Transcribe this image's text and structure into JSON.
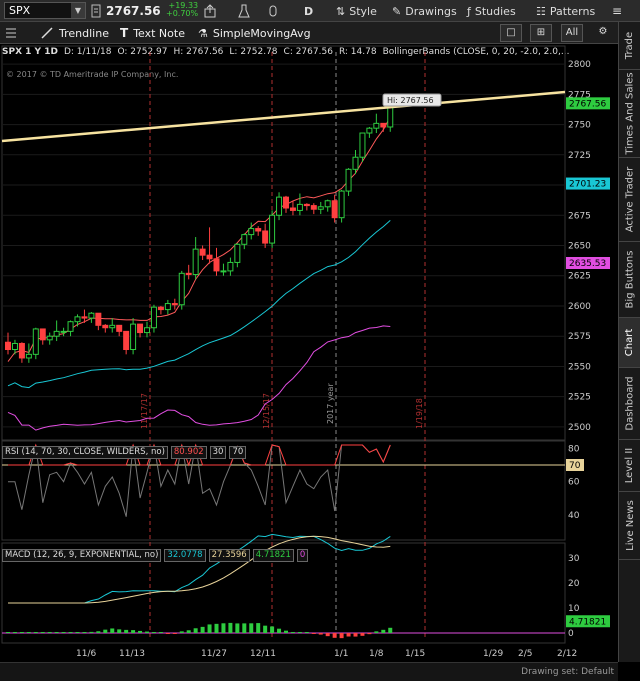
{
  "toolbar": {
    "symbol": "SPX",
    "last_price": "2767.56",
    "change": "+19.33",
    "change_pct": "+0.70%",
    "period_letter": "D",
    "style_label": "Style",
    "drawings_label": "Drawings",
    "studies_label": "Studies",
    "patterns_label": "Patterns"
  },
  "toolbar2": {
    "trendline_label": "Trendline",
    "textnote_label": "Text Note",
    "sma_label": "SimpleMovingAvg",
    "grid_label": "All"
  },
  "info": {
    "symbol_period": "SPX 1 Y 1D",
    "date": "D: 1/11/18",
    "open": "O: 2752.97",
    "high": "H: 2767.56",
    "low": "L: 2752.78",
    "close": "C: 2767.56",
    "range": "R: 14.78",
    "study": "BollingerBands (CLOSE, 0, 20, -2.0, 2.0,...",
    "copyright": "© 2017 © TD Ameritrade IP Company, Inc."
  },
  "sidetabs": [
    "Trade",
    "Times And Sales",
    "Active Trader",
    "Big Buttons",
    "Chart",
    "Dashboard",
    "Level II",
    "Live News"
  ],
  "active_tab": "Chart",
  "price_axis": [
    "2800",
    "2775",
    "2750",
    "2725",
    "2700",
    "2675",
    "2650",
    "2625",
    "2600",
    "2575",
    "2550",
    "2525",
    "2500"
  ],
  "price_tags": {
    "last": "2767.56",
    "upper": "2701.23",
    "lower": "2635.53",
    "hi_callout": "Hi: 2767.56"
  },
  "vertical_markers": [
    "11/17/17",
    "12/15/17",
    "2017 year",
    "1/19/18"
  ],
  "rsi": {
    "label": "RSI (14, 70, 30, CLOSE, WILDERS, no)",
    "value": "80.902",
    "oversold": "30",
    "overbought": "70",
    "axis": [
      "80",
      "60",
      "40"
    ],
    "tag": "70"
  },
  "macd": {
    "label": "MACD (12, 26, 9, EXPONENTIAL, no)",
    "value": "32.0778",
    "avg": "27.3596",
    "diff": "4.71821",
    "zero": "0",
    "axis": [
      "30",
      "20",
      "10",
      "0"
    ],
    "tag": "4.71821"
  },
  "date_axis": [
    "11/6",
    "11/13",
    "11/27",
    "12/11",
    "1/1",
    "1/8",
    "1/15",
    "1/29",
    "2/5",
    "2/12"
  ],
  "status": {
    "drawing_set": "Drawing set: Default"
  },
  "colors": {
    "up": "#2ecc40",
    "down": "#ff4040",
    "upper_band": "#ff5a5a",
    "mid_band": "#19c7d4",
    "lower_band": "#e14ee1",
    "trendline": "#f7e3a0",
    "marker": "#b03030"
  },
  "chart_data": {
    "type": "candlestick",
    "symbol": "SPX",
    "ylim": [
      2490,
      2810
    ],
    "x": [
      "10/23",
      "10/24",
      "10/25",
      "10/26",
      "10/27",
      "10/30",
      "10/31",
      "11/1",
      "11/2",
      "11/3",
      "11/6",
      "11/7",
      "11/8",
      "11/9",
      "11/10",
      "11/13",
      "11/14",
      "11/15",
      "11/16",
      "11/17",
      "11/20",
      "11/21",
      "11/22",
      "11/24",
      "11/27",
      "11/28",
      "11/29",
      "11/30",
      "12/1",
      "12/4",
      "12/5",
      "12/6",
      "12/7",
      "12/8",
      "12/11",
      "12/12",
      "12/13",
      "12/14",
      "12/15",
      "12/18",
      "12/19",
      "12/20",
      "12/21",
      "12/22",
      "12/26",
      "12/27",
      "12/28",
      "12/29",
      "1/2",
      "1/3",
      "1/4",
      "1/5",
      "1/8",
      "1/9",
      "1/10",
      "1/11"
    ],
    "close": [
      2564,
      2569,
      2557,
      2560,
      2581,
      2572,
      2575,
      2579,
      2579,
      2587,
      2591,
      2590,
      2594,
      2584,
      2582,
      2584,
      2579,
      2564,
      2585,
      2578,
      2582,
      2599,
      2597,
      2602,
      2601,
      2627,
      2626,
      2647,
      2642,
      2639,
      2629,
      2629,
      2636,
      2651,
      2659,
      2664,
      2662,
      2652,
      2675,
      2690,
      2681,
      2679,
      2684,
      2683,
      2680,
      2682,
      2687,
      2673,
      2695,
      2713,
      2723,
      2743,
      2747,
      2751,
      2748,
      2767
    ],
    "high": [
      2578,
      2572,
      2570,
      2569,
      2582,
      2580,
      2578,
      2588,
      2582,
      2588,
      2593,
      2597,
      2595,
      2592,
      2585,
      2590,
      2584,
      2572,
      2590,
      2585,
      2587,
      2601,
      2600,
      2605,
      2606,
      2629,
      2634,
      2657,
      2650,
      2665,
      2648,
      2635,
      2640,
      2652,
      2660,
      2669,
      2666,
      2668,
      2679,
      2694,
      2691,
      2687,
      2693,
      2685,
      2685,
      2686,
      2688,
      2692,
      2696,
      2714,
      2729,
      2743,
      2748,
      2759,
      2751,
      2767
    ]
  }
}
